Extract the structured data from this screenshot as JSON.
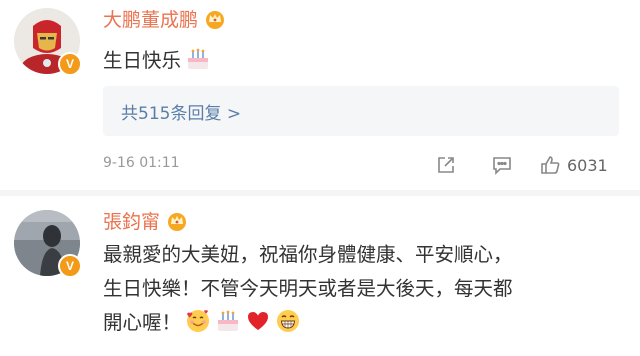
{
  "comments": [
    {
      "username": "大鹏董成鹏",
      "verified_badge": "V",
      "text_lines": [
        "生日快乐"
      ],
      "emojis": [
        "cake-emoji"
      ],
      "replies_label": "共515条回复 >",
      "timestamp": "9-16 01:11",
      "like_count": "6031"
    },
    {
      "username": "張鈞甯",
      "verified_badge": "V",
      "text_lines": [
        "最親愛的大美妞，祝福你身體健康、平安順心，",
        "生日快樂！不管今天明天或者是大後天，每天都",
        "開心喔！"
      ],
      "emojis": [
        "smiling-hearts-emoji",
        "cake-emoji",
        "red-heart-emoji",
        "grinning-emoji"
      ]
    }
  ],
  "colors": {
    "username": "#eb7350",
    "link": "#5b7ea8",
    "verified": "#f39a18",
    "meta": "#999999"
  }
}
